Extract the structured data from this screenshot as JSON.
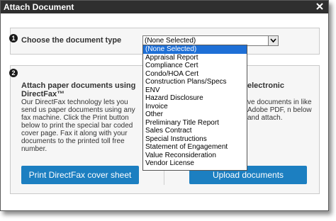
{
  "window": {
    "title": "Attach Document"
  },
  "step1": {
    "number": "1",
    "label": "Choose the document type",
    "select_value": "(None Selected)",
    "options": [
      "(None Selected)",
      "Appraisal Report",
      "Compliance Cert",
      "Condo/HOA Cert",
      "Construction Plans/Specs",
      "ENV",
      "Hazard Disclosure",
      "Invoice",
      "Other",
      "Preliminary Title Report",
      "Sales Contract",
      "Special Instructions",
      "Statement of Engagement",
      "Value Reconsideration",
      "Vendor License"
    ]
  },
  "step2": {
    "number": "2",
    "left_heading": "Attach paper documents using DirectFax™",
    "left_text": "Our DirectFax technology lets you send us paper documents using any fax machine. Click the Print button below to print the special bar coded cover page. Fax it along with your documents to the printed toll free number.",
    "right_heading": "electronic",
    "right_text": "ve documents in like Adobe PDF, n below and attach.",
    "print_button": "Print DirectFax cover sheet",
    "upload_button": "Upload documents"
  },
  "colors": {
    "titlebar": "#2f2f2f",
    "button": "#1c7fc1",
    "selected_option": "#1e6fd6"
  }
}
